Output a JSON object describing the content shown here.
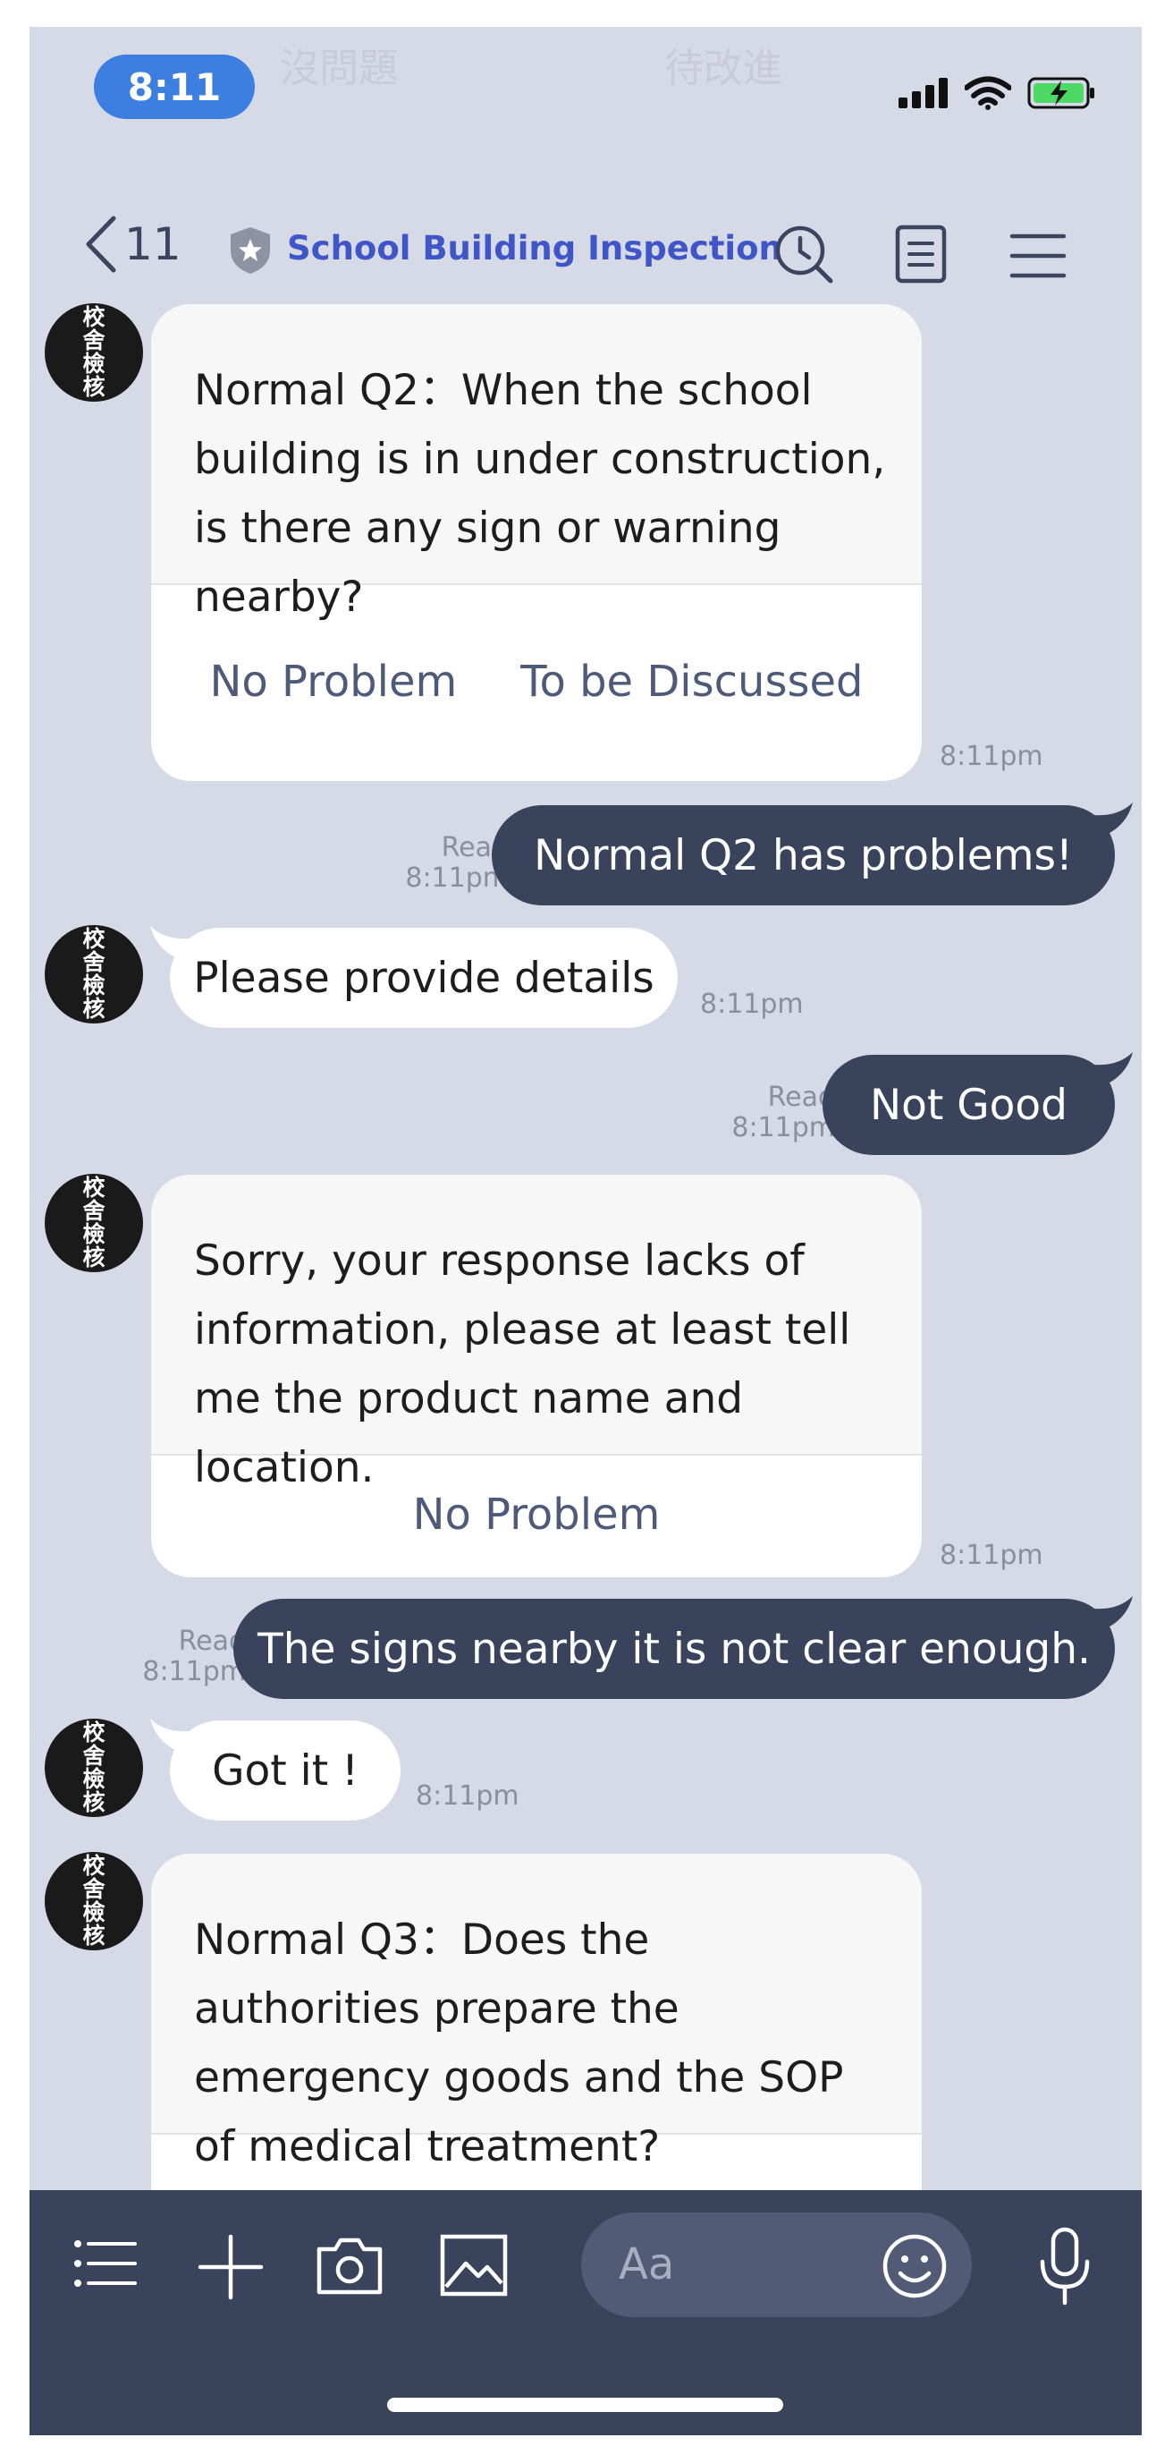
{
  "status_bar": {
    "time": "8:11",
    "background_labels": [
      "沒問題",
      "待改進"
    ]
  },
  "header": {
    "back_count": "11",
    "title": "School Building Inspection",
    "icons": [
      "chevron-left-icon",
      "shield-star-icon",
      "clock-search-icon",
      "notes-icon",
      "menu-icon"
    ]
  },
  "bot": {
    "avatar_text": "校舍檢核"
  },
  "messages": {
    "m1": {
      "text": "Normal Q2：When the school building is in under construction, is there any sign or warning nearby?",
      "buttons": [
        "No Problem",
        "To be Discussed"
      ],
      "time": "8:11pm"
    },
    "m2": {
      "text": "Normal Q2 has problems!",
      "read": "Read",
      "time": "8:11pm"
    },
    "m3": {
      "text": "Please provide details",
      "time": "8:11pm"
    },
    "m4": {
      "text": "Not Good",
      "read": "Read",
      "time": "8:11pm"
    },
    "m5": {
      "text": "Sorry, your response lacks of information, please at least tell me the product name and location.",
      "buttons": [
        "No Problem"
      ],
      "time": "8:11pm"
    },
    "m6": {
      "text": "The signs nearby it is not clear enough.",
      "read": "Read",
      "time": "8:11pm"
    },
    "m7": {
      "text": "Got it !",
      "time": "8:11pm"
    },
    "m8": {
      "text": "Normal Q3：Does the authorities prepare the emergency goods and the SOP of medical treatment?"
    }
  },
  "input": {
    "placeholder": "Aa"
  },
  "colors": {
    "chat_background": "#d6d9e6",
    "outgoing_bubble": "#3a435c",
    "title_blue": "#3f56c8",
    "time_pill": "#3d7fe0"
  }
}
